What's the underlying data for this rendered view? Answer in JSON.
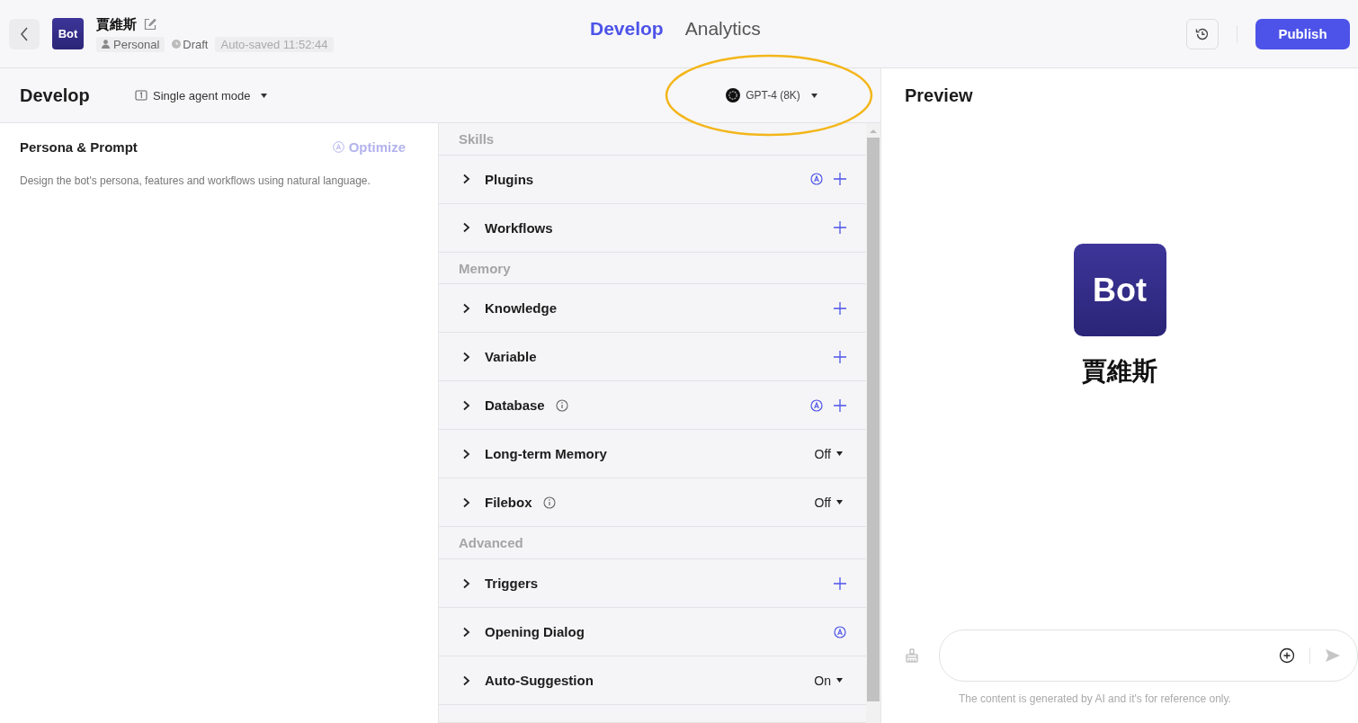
{
  "header": {
    "avatar": "Bot",
    "bot_name": "賈維斯",
    "space": "Personal",
    "status": "Draft",
    "autosave": "Auto-saved 11:52:44",
    "tabs": [
      {
        "label": "Develop",
        "selected": true
      },
      {
        "label": "Analytics",
        "selected": false
      }
    ],
    "publish": "Publish"
  },
  "develop_bar": {
    "title": "Develop",
    "mode": "Single agent mode",
    "model": "GPT-4 (8K)"
  },
  "persona": {
    "title": "Persona & Prompt",
    "optimize": "Optimize",
    "placeholder": "Design the bot's persona, features and workflows using natural language."
  },
  "sections": [
    {
      "title": "Skills",
      "items": [
        {
          "name": "Plugins",
          "info": false,
          "auto": true,
          "kind": "add"
        },
        {
          "name": "Workflows",
          "info": false,
          "auto": false,
          "kind": "add"
        }
      ]
    },
    {
      "title": "Memory",
      "items": [
        {
          "name": "Knowledge",
          "info": false,
          "auto": false,
          "kind": "add"
        },
        {
          "name": "Variable",
          "info": false,
          "auto": false,
          "kind": "add"
        },
        {
          "name": "Database",
          "info": true,
          "auto": true,
          "kind": "add"
        },
        {
          "name": "Long-term Memory",
          "info": false,
          "auto": false,
          "kind": "select",
          "value": "Off"
        },
        {
          "name": "Filebox",
          "info": true,
          "auto": false,
          "kind": "select",
          "value": "Off"
        }
      ]
    },
    {
      "title": "Advanced",
      "items": [
        {
          "name": "Triggers",
          "info": false,
          "auto": false,
          "kind": "add"
        },
        {
          "name": "Opening Dialog",
          "info": false,
          "auto": true,
          "kind": "none"
        },
        {
          "name": "Auto-Suggestion",
          "info": false,
          "auto": false,
          "kind": "select",
          "value": "On"
        }
      ]
    }
  ],
  "preview": {
    "title": "Preview",
    "avatar": "Bot",
    "bot_name": "賈維斯",
    "disclaimer": "The content is generated by AI and it's for reference only."
  }
}
